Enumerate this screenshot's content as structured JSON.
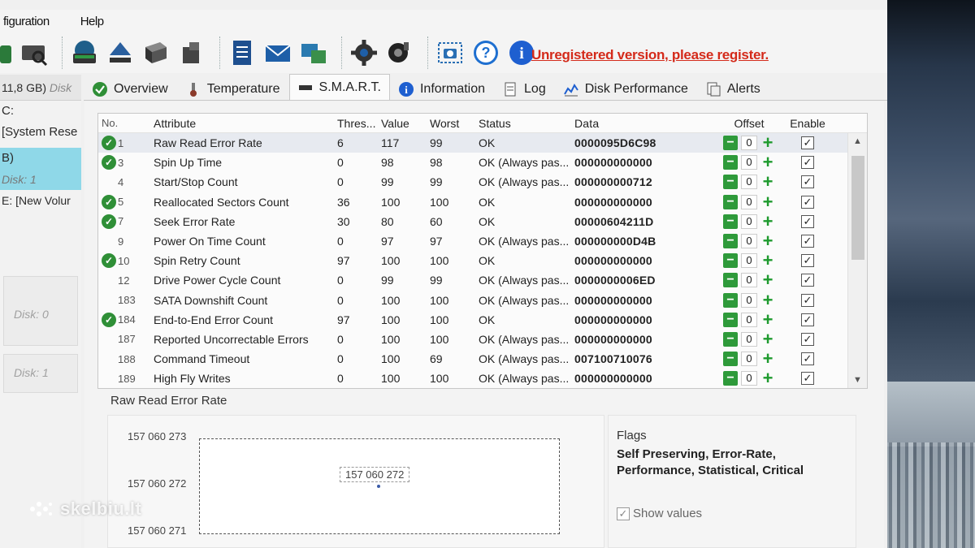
{
  "menu": {
    "item1": "figuration",
    "item2": "Help"
  },
  "unregistered": "Unregistered version, please register.",
  "left": {
    "disk_head": "11,8 GB)",
    "disk_head_suffix": "Disk",
    "lines": [
      "C:",
      "[System Rese"
    ],
    "sel_label": "B)",
    "item_disk1": "Disk: 1",
    "item_e": "E: [New Volur",
    "box1": "Disk: 0",
    "box2": "Disk: 1"
  },
  "tabs": [
    {
      "label": "Overview",
      "icon": "check-circle-icon"
    },
    {
      "label": "Temperature",
      "icon": "thermometer-icon"
    },
    {
      "label": "S.M.A.R.T.",
      "icon": "smart-icon"
    },
    {
      "label": "Information",
      "icon": "info-icon"
    },
    {
      "label": "Log",
      "icon": "log-icon"
    },
    {
      "label": "Disk Performance",
      "icon": "performance-icon"
    },
    {
      "label": "Alerts",
      "icon": "alerts-icon"
    }
  ],
  "table": {
    "headers": {
      "no": "No.",
      "attr": "Attribute",
      "thr": "Thres...",
      "val": "Value",
      "wst": "Worst",
      "st": "Status",
      "data": "Data",
      "off": "Offset",
      "en": "Enable"
    },
    "rows": [
      {
        "ok": true,
        "no": "1",
        "attr": "Raw Read Error Rate",
        "thr": "6",
        "val": "117",
        "wst": "99",
        "st": "OK",
        "data": "0000095D6C98",
        "off": "0"
      },
      {
        "ok": true,
        "no": "3",
        "attr": "Spin Up Time",
        "thr": "0",
        "val": "98",
        "wst": "98",
        "st": "OK (Always pas...",
        "data": "000000000000",
        "off": "0"
      },
      {
        "ok": false,
        "no": "4",
        "attr": "Start/Stop Count",
        "thr": "0",
        "val": "99",
        "wst": "99",
        "st": "OK (Always pas...",
        "data": "000000000712",
        "off": "0"
      },
      {
        "ok": true,
        "no": "5",
        "attr": "Reallocated Sectors Count",
        "thr": "36",
        "val": "100",
        "wst": "100",
        "st": "OK",
        "data": "000000000000",
        "off": "0"
      },
      {
        "ok": true,
        "no": "7",
        "attr": "Seek Error Rate",
        "thr": "30",
        "val": "80",
        "wst": "60",
        "st": "OK",
        "data": "00000604211D",
        "off": "0"
      },
      {
        "ok": false,
        "no": "9",
        "attr": "Power On Time Count",
        "thr": "0",
        "val": "97",
        "wst": "97",
        "st": "OK (Always pas...",
        "data": "000000000D4B",
        "off": "0"
      },
      {
        "ok": true,
        "no": "10",
        "attr": "Spin Retry Count",
        "thr": "97",
        "val": "100",
        "wst": "100",
        "st": "OK",
        "data": "000000000000",
        "off": "0"
      },
      {
        "ok": false,
        "no": "12",
        "attr": "Drive Power Cycle Count",
        "thr": "0",
        "val": "99",
        "wst": "99",
        "st": "OK (Always pas...",
        "data": "0000000006ED",
        "off": "0"
      },
      {
        "ok": false,
        "no": "183",
        "attr": "SATA Downshift Count",
        "thr": "0",
        "val": "100",
        "wst": "100",
        "st": "OK (Always pas...",
        "data": "000000000000",
        "off": "0"
      },
      {
        "ok": true,
        "no": "184",
        "attr": "End-to-End Error Count",
        "thr": "97",
        "val": "100",
        "wst": "100",
        "st": "OK",
        "data": "000000000000",
        "off": "0"
      },
      {
        "ok": false,
        "no": "187",
        "attr": "Reported Uncorrectable Errors",
        "thr": "0",
        "val": "100",
        "wst": "100",
        "st": "OK (Always pas...",
        "data": "000000000000",
        "off": "0"
      },
      {
        "ok": false,
        "no": "188",
        "attr": "Command Timeout",
        "thr": "0",
        "val": "100",
        "wst": "69",
        "st": "OK (Always pas...",
        "data": "007100710076",
        "off": "0"
      },
      {
        "ok": false,
        "no": "189",
        "attr": "High Fly Writes",
        "thr": "0",
        "val": "100",
        "wst": "100",
        "st": "OK (Always pas...",
        "data": "000000000000",
        "off": "0"
      }
    ]
  },
  "graph": {
    "title": "Raw Read Error Rate",
    "y_top": "157 060 273",
    "y_mid": "157 060 272",
    "y_bot": "157 060 271",
    "point_label": "157 060 272"
  },
  "flags": {
    "label": "Flags",
    "text": "Self Preserving, Error-Rate, Performance, Statistical, Critical",
    "show_values": "Show values"
  },
  "watermark": "skelbiu.lt",
  "colors": {
    "ok": "#2f8f37",
    "unregistered": "#d42a1a",
    "selected_disk": "#8fd8e8"
  }
}
